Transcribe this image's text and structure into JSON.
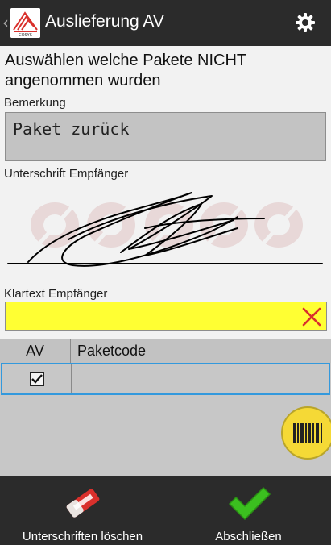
{
  "app": {
    "title": "Auslieferung AV",
    "logo_text": "COSYS"
  },
  "form": {
    "instruction": "Auswählen welche Pakete NICHT angenommen wurden",
    "remark_label": "Bemerkung",
    "remark_value": "Paket zurück",
    "signature_label": "Unterschrift Empfänger",
    "klartext_label": "Klartext Empfänger",
    "klartext_value": ""
  },
  "table": {
    "columns": [
      "AV",
      "Paketcode"
    ],
    "rows": [
      {
        "av_checked": true,
        "paketcode": ""
      }
    ]
  },
  "bottom": {
    "clear_signatures": "Unterschriften löschen",
    "finish": "Abschließen"
  },
  "colors": {
    "appbar": "#2b2b2b",
    "klartext_field": "#ffff33",
    "scan_button": "#f5d936",
    "selection": "#3399dd",
    "finish_icon": "#3bbf1f",
    "clear_icon": "#d9302c"
  },
  "icons": {
    "back": "chevron-left-icon",
    "settings": "gear-icon",
    "clear_field": "close-icon",
    "scan": "barcode-icon",
    "clear_signatures": "eraser-icon",
    "finish": "checkmark-icon"
  }
}
